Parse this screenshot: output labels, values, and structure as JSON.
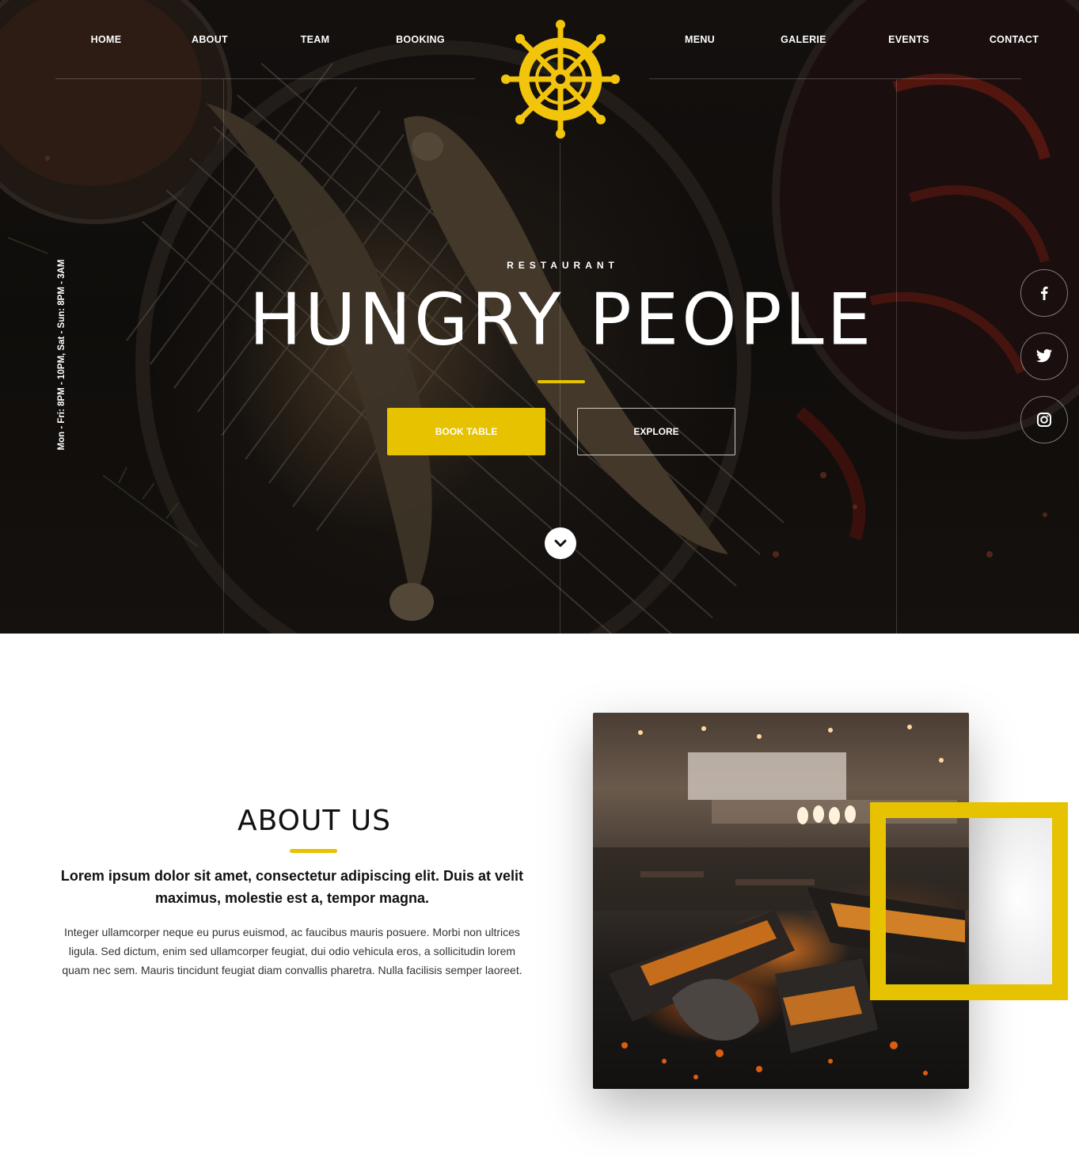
{
  "nav": {
    "left": [
      "HOME",
      "ABOUT",
      "TEAM",
      "BOOKING"
    ],
    "right": [
      "MENU",
      "GALERIE",
      "EVENTS",
      "CONTACT"
    ]
  },
  "logo": {
    "icon": "ship-wheel-icon",
    "color": "#f2c40c"
  },
  "hero": {
    "opening_hours": "Mon - Fri: 8PM - 10PM, Sat - Sun: 8PM - 3AM",
    "eyebrow": "RESTAURANT",
    "title": "HUNGRY PEOPLE",
    "book_button": "BOOK TABLE",
    "explore_button": "EXPLORE",
    "scroll_icon": "chevron-down-icon"
  },
  "social": [
    {
      "icon": "facebook-icon"
    },
    {
      "icon": "twitter-icon"
    },
    {
      "icon": "instagram-icon"
    }
  ],
  "about": {
    "title": "ABOUT US",
    "lead": "Lorem ipsum dolor sit amet, consectetur adipiscing elit. Duis at velit maximus, molestie est a, tempor magna.",
    "body": "Integer ullamcorper neque eu purus euismod, ac faucibus mauris posuere. Morbi non ultrices ligula. Sed dictum, enim sed ullamcorper feugiat, dui odio vehicula eros, a sollicitudin lorem quam nec sem. Mauris tincidunt feugiat diam convallis pharetra. Nulla facilisis semper laoreet."
  },
  "colors": {
    "accent": "#e6c200",
    "hero_bg": "#14110f",
    "text_dark": "#111111"
  }
}
